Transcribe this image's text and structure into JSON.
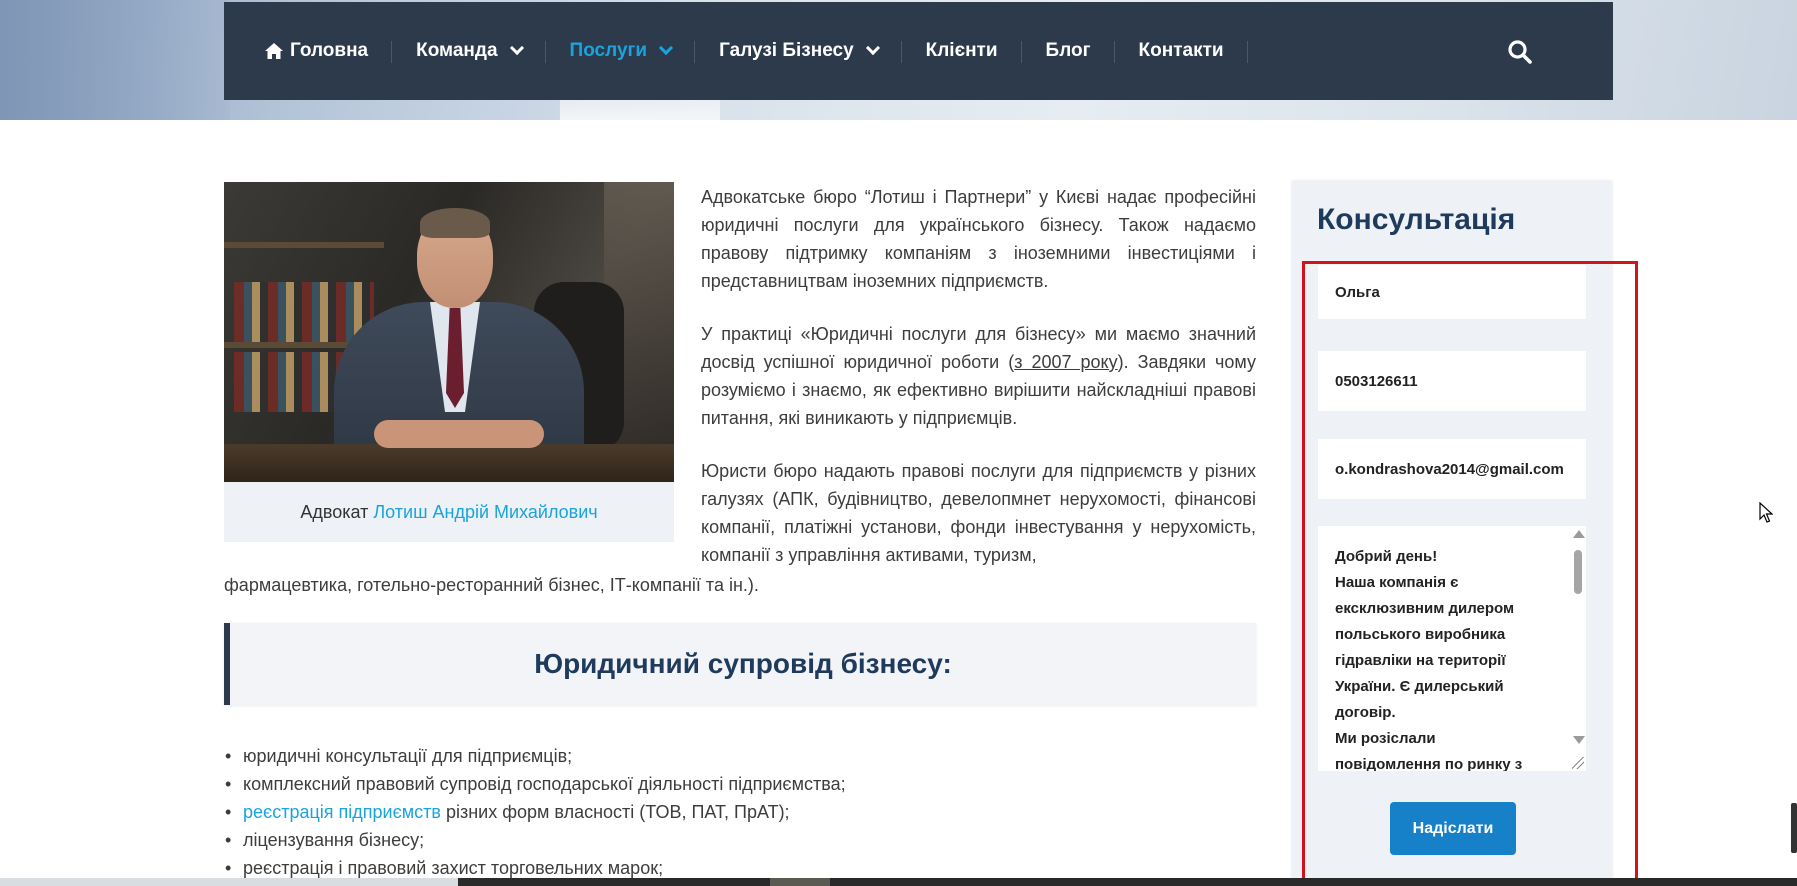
{
  "nav": {
    "items": [
      {
        "label": "Головна",
        "icon": "home-icon",
        "active": false,
        "has_dropdown": false
      },
      {
        "label": "Команда",
        "active": false,
        "has_dropdown": true
      },
      {
        "label": "Послуги",
        "active": true,
        "has_dropdown": true
      },
      {
        "label": "Галузі Бізнесу",
        "active": false,
        "has_dropdown": true
      },
      {
        "label": "Клієнти",
        "active": false,
        "has_dropdown": false
      },
      {
        "label": "Блог",
        "active": false,
        "has_dropdown": false
      },
      {
        "label": "Контакти",
        "active": false,
        "has_dropdown": false
      }
    ],
    "search_icon": "search-icon"
  },
  "article": {
    "photo_caption_prefix": "Адвокат",
    "photo_caption_link": "Лотиш Андрій Михайлович",
    "para1": "Адвокатське бюро “Лотиш і Партнери” у Києві надає професійні юридичні послуги для українського бізнесу. Також надаємо правову підтримку компаніям з іноземними інвестиціями і представництвам іноземних підприємств.",
    "para2_before": "У практиці «Юридичні послуги для бізнесу» ми маємо значний досвід успішної юридичної роботи (",
    "para2_link": "з 2007 року",
    "para2_after": "). Завдяки чому розуміємо і знаємо, як ефективно вирішити найскладніші правові питання, які виникають у підприємців.",
    "para3": "Юристи бюро надають правові послуги для підприємств у різних галузях (АПК, будівництво, девелопмнет нерухомості, фінансові компанії, платіжні установи, фонди інвестування у нерухомість, компанії з управління активами, туризм,",
    "para3_tail": "фармацевтика, готельно-ресторанний бізнес, ІТ-компанії та ін.).",
    "section_title": "Юридичний супровід бізнесу:",
    "bullets": [
      {
        "text": "юридичні консультації для підприємців;"
      },
      {
        "text": "комплексний правовий супровід господарської діяльності підприємства;"
      },
      {
        "link": "реєстрація підприємств",
        "text": " різних форм власності (ТОВ, ПАТ, ПрАТ);"
      },
      {
        "text": "ліцензування бізнесу;"
      },
      {
        "text": "реєстрація і правовий захист торговельних марок;"
      }
    ]
  },
  "sidebar": {
    "title": "Консультація",
    "name_value": "Ольга",
    "phone_value": "0503126611",
    "email_value": "o.kondrashova2014@gmail.com",
    "message_lines": [
      "Добрий день!",
      "Наша компанія є",
      "ексклюзивним дилером",
      "польського виробника",
      "гідравліки на території",
      "України. Є дилерський",
      "договір.",
      "Ми розіслали",
      "повідомлення по ринку з"
    ],
    "submit_label": "Надіслати"
  },
  "colors": {
    "nav_bg": "#2d3a4c",
    "accent": "#1aa3dd",
    "heading": "#1e3a5c",
    "button": "#1680c9",
    "highlight": "#d0141c"
  }
}
